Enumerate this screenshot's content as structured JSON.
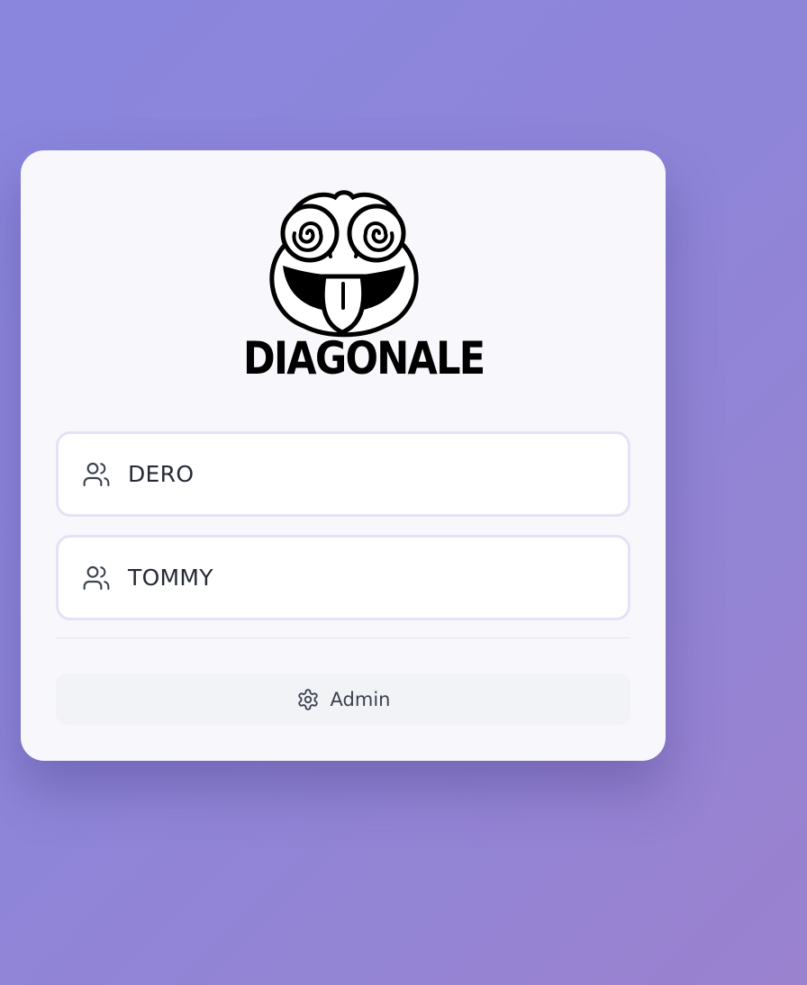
{
  "logo": {
    "text": "DIAGONALE",
    "icon": "frog-face-logo"
  },
  "users": [
    {
      "label": "DERO",
      "icon": "users-icon"
    },
    {
      "label": "TOMMY",
      "icon": "users-icon"
    }
  ],
  "admin": {
    "label": "Admin",
    "icon": "gear-icon"
  },
  "colors": {
    "card_background": "#f8f8fc",
    "button_border": "#e3e2f6",
    "admin_background": "#f2f3f6",
    "text": "#262a35"
  }
}
